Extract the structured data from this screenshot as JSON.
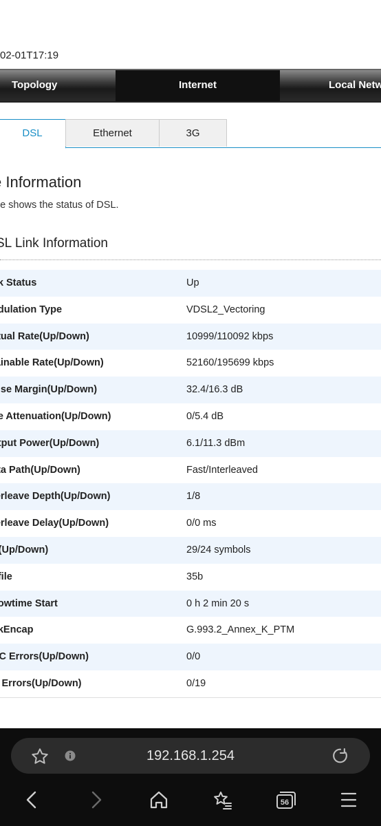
{
  "header": {
    "timestamp": "02-01T17:19"
  },
  "topnav": {
    "items": [
      {
        "label": "Topology",
        "active": false
      },
      {
        "label": "Internet",
        "active": true
      },
      {
        "label": "Local Netw",
        "active": false
      }
    ]
  },
  "tabs": [
    {
      "label": "DSL",
      "active": true
    },
    {
      "label": "Ethernet",
      "active": false
    },
    {
      "label": "3G",
      "active": false
    }
  ],
  "page": {
    "heading": "e Information",
    "description": "ge shows the status of DSL."
  },
  "section": {
    "title": "SL Link Information"
  },
  "rows": [
    {
      "label": "nk Status",
      "value": "Up"
    },
    {
      "label": "odulation Type",
      "value": "VDSL2_Vectoring"
    },
    {
      "label": "ctual Rate(Up/Down)",
      "value": "10999/110092 kbps"
    },
    {
      "label": "tainable Rate(Up/Down)",
      "value": "52160/195699 kbps"
    },
    {
      "label": "oise Margin(Up/Down)",
      "value": "32.4/16.3 dB"
    },
    {
      "label": "ne Attenuation(Up/Down)",
      "value": "0/5.4 dB"
    },
    {
      "label": "utput Power(Up/Down)",
      "value": "6.1/11.3 dBm"
    },
    {
      "label": "ata Path(Up/Down)",
      "value": "Fast/Interleaved"
    },
    {
      "label": "terleave Depth(Up/Down)",
      "value": "1/8"
    },
    {
      "label": "terleave Delay(Up/Down)",
      "value": "0/0 ms"
    },
    {
      "label": "P(Up/Down)",
      "value": "29/24 symbols"
    },
    {
      "label": "ofile",
      "value": "35b"
    },
    {
      "label": "nowtime Start",
      "value": "0 h 2 min 20 s"
    },
    {
      "label": "nkEncap",
      "value": "G.993.2_Annex_K_PTM"
    },
    {
      "label": "RC Errors(Up/Down)",
      "value": "0/0"
    },
    {
      "label": "C Errors(Up/Down)",
      "value": "0/19"
    }
  ],
  "browser": {
    "url": "192.168.1.254",
    "tab_count": "56",
    "icons": [
      "star-icon",
      "info-icon",
      "reload-icon",
      "back-icon",
      "forward-icon",
      "home-icon",
      "bookmarks-icon",
      "tabs-icon",
      "menu-icon"
    ]
  },
  "colors": {
    "accent": "#1a8fc6",
    "row_alt": "#eef5fd",
    "nav_dark": "#111111"
  }
}
